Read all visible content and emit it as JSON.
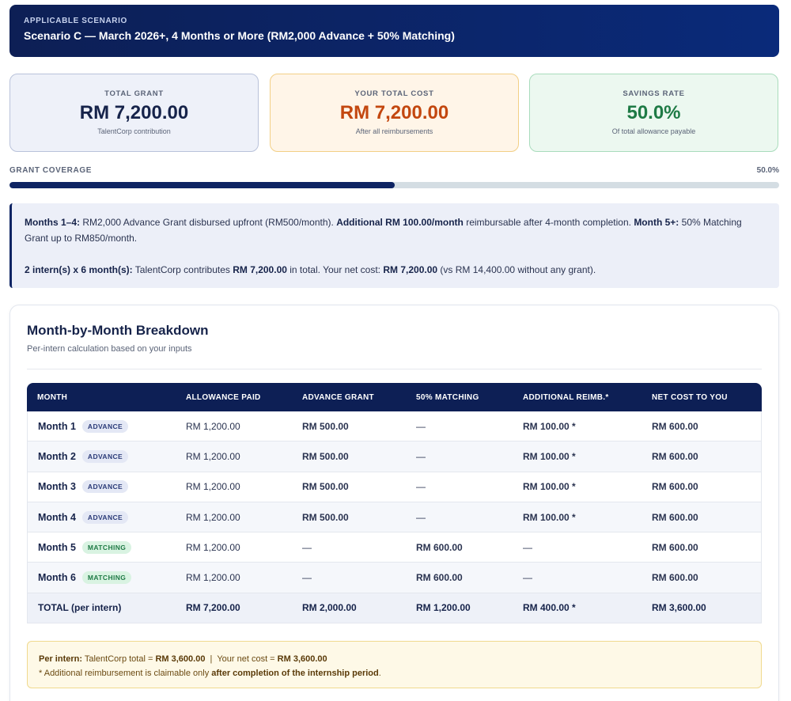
{
  "scenario": {
    "eyebrow": "APPLICABLE SCENARIO",
    "title": "Scenario C — March 2026+, 4 Months or More (RM2,000 Advance + 50% Matching)"
  },
  "cards": {
    "grant": {
      "label": "TOTAL GRANT",
      "value": "RM 7,200.00",
      "sub": "TalentCorp contribution"
    },
    "cost": {
      "label": "YOUR TOTAL COST",
      "value": "RM 7,200.00",
      "sub": "After all reimbursements"
    },
    "savings": {
      "label": "SAVINGS RATE",
      "value": "50.0%",
      "sub": "Of total allowance payable"
    }
  },
  "coverage": {
    "label": "GRANT COVERAGE",
    "value_text": "50.0%",
    "fraction": 0.5
  },
  "info": {
    "p1": {
      "a_bold": "Months 1–4:",
      "a": " RM2,000 Advance Grant disbursed upfront (RM500/month). ",
      "b_bold": "Additional RM 100.00/month",
      "b": " reimbursable after 4-month completion. ",
      "c_bold": "Month 5+:",
      "c": " 50% Matching Grant up to RM850/month."
    },
    "p2": {
      "a_bold": "2 intern(s) x 6 month(s):",
      "a": " TalentCorp contributes ",
      "b_bold": "RM 7,200.00",
      "b": " in total. Your net cost: ",
      "c_bold": "RM 7,200.00",
      "c": " (vs RM 14,400.00 without any grant)."
    }
  },
  "breakdown": {
    "title": "Month-by-Month Breakdown",
    "subtitle": "Per-intern calculation based on your inputs",
    "headers": [
      "MONTH",
      "ALLOWANCE PAID",
      "ADVANCE GRANT",
      "50% MATCHING",
      "ADDITIONAL REIMB.*",
      "NET COST TO YOU"
    ],
    "rows": [
      {
        "month": "Month 1",
        "badge": "ADVANCE",
        "allowance": "RM 1,200.00",
        "advance": "RM 500.00",
        "matching": "—",
        "reimb": "RM 100.00 *",
        "net": "RM 600.00"
      },
      {
        "month": "Month 2",
        "badge": "ADVANCE",
        "allowance": "RM 1,200.00",
        "advance": "RM 500.00",
        "matching": "—",
        "reimb": "RM 100.00 *",
        "net": "RM 600.00"
      },
      {
        "month": "Month 3",
        "badge": "ADVANCE",
        "allowance": "RM 1,200.00",
        "advance": "RM 500.00",
        "matching": "—",
        "reimb": "RM 100.00 *",
        "net": "RM 600.00"
      },
      {
        "month": "Month 4",
        "badge": "ADVANCE",
        "allowance": "RM 1,200.00",
        "advance": "RM 500.00",
        "matching": "—",
        "reimb": "RM 100.00 *",
        "net": "RM 600.00"
      },
      {
        "month": "Month 5",
        "badge": "MATCHING",
        "allowance": "RM 1,200.00",
        "advance": "—",
        "matching": "RM 600.00",
        "reimb": "—",
        "net": "RM 600.00"
      },
      {
        "month": "Month 6",
        "badge": "MATCHING",
        "allowance": "RM 1,200.00",
        "advance": "—",
        "matching": "RM 600.00",
        "reimb": "—",
        "net": "RM 600.00"
      }
    ],
    "total": {
      "label": "TOTAL (per intern)",
      "allowance": "RM 7,200.00",
      "advance": "RM 2,000.00",
      "matching": "RM 1,200.00",
      "reimb": "RM 400.00 *",
      "net": "RM 3,600.00"
    }
  },
  "note": {
    "l1_a_bold": "Per intern:",
    "l1_a": " TalentCorp total = ",
    "l1_b_bold": "RM 3,600.00",
    "l1_b": "  |  Your net cost = ",
    "l1_c_bold": "RM 3,600.00",
    "l2_a": "* Additional reimbursement is claimable only ",
    "l2_b_bold": "after completion of the internship period",
    "l2_c": "."
  }
}
